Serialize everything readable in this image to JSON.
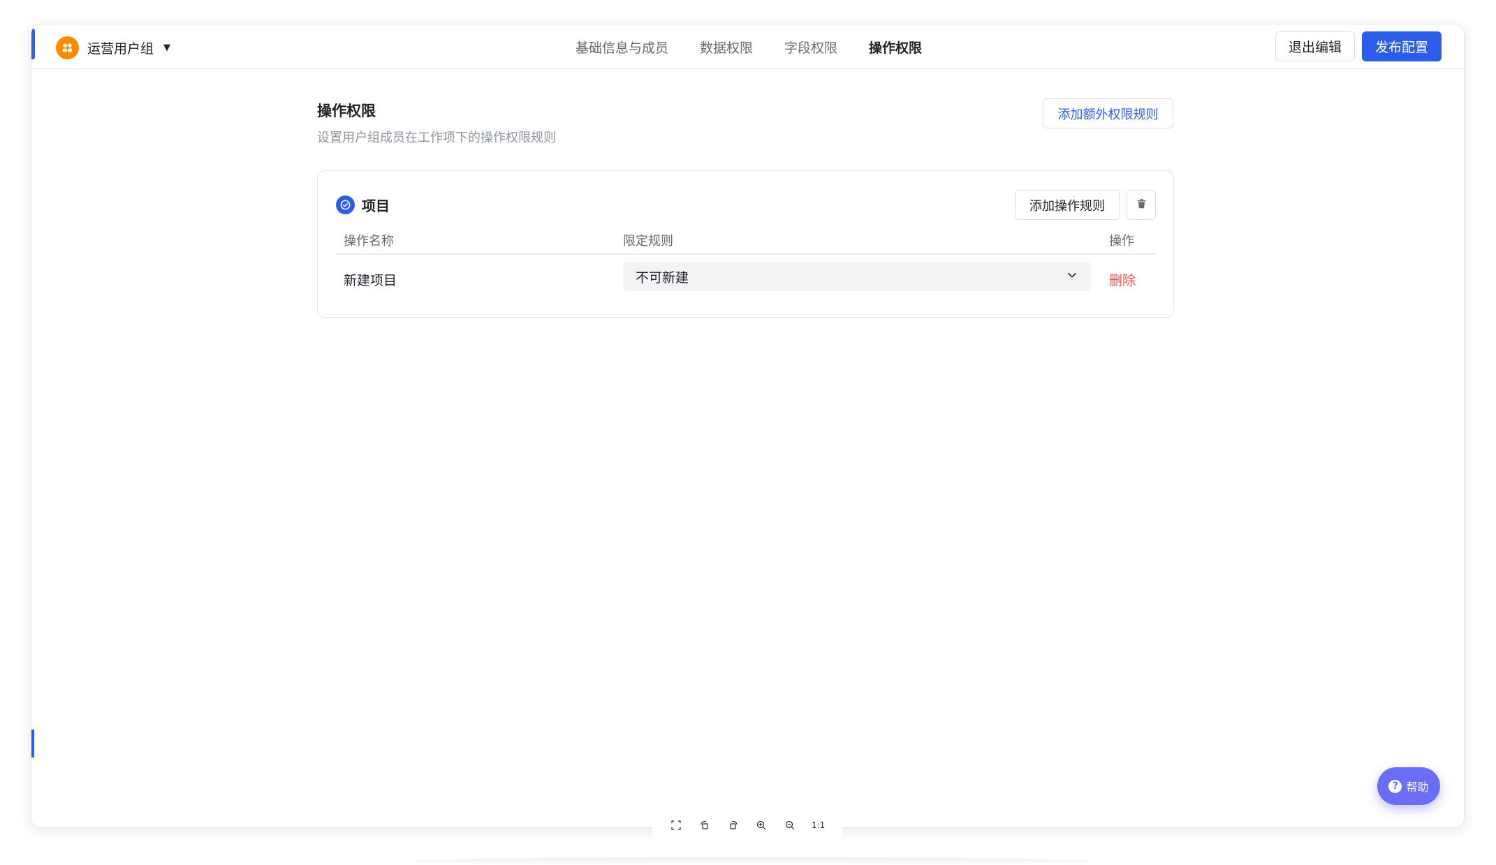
{
  "header": {
    "group_name": "运营用户组",
    "tabs": [
      {
        "label": "基础信息与成员",
        "active": false
      },
      {
        "label": "数据权限",
        "active": false
      },
      {
        "label": "字段权限",
        "active": false
      },
      {
        "label": "操作权限",
        "active": true
      }
    ],
    "exit_label": "退出编辑",
    "publish_label": "发布配置"
  },
  "section": {
    "title": "操作权限",
    "description": "设置用户组成员在工作项下的操作权限规则",
    "add_extra_rule_label": "添加额外权限规则"
  },
  "panel": {
    "title": "项目",
    "add_rule_label": "添加操作规则",
    "columns": {
      "name": "操作名称",
      "rule": "限定规则",
      "action": "操作"
    },
    "rows": [
      {
        "name": "新建项目",
        "rule": "不可新建",
        "action": "删除"
      }
    ]
  },
  "help": {
    "label": "帮助"
  },
  "zoombar": {
    "reset_label": "1:1"
  },
  "colors": {
    "primary": "#2b5de8",
    "danger": "#f54a45",
    "group_icon": "#ff8a00",
    "help": "#6a6ef6"
  }
}
